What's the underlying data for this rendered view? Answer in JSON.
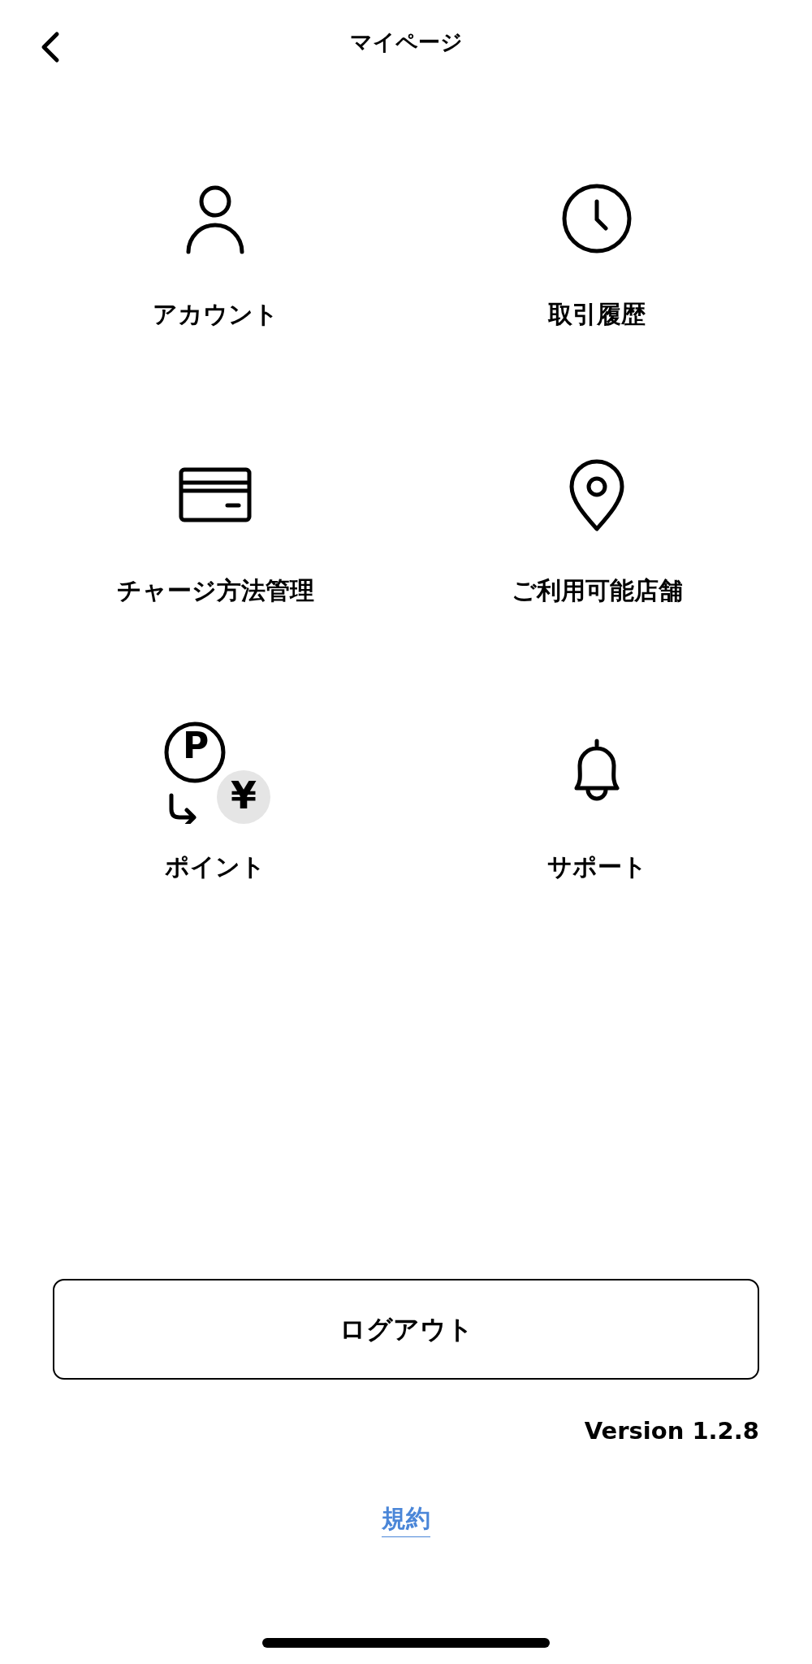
{
  "header": {
    "title": "マイページ"
  },
  "menu": [
    {
      "kind": "person",
      "label": "アカウント"
    },
    {
      "kind": "clock",
      "label": "取引履歴"
    },
    {
      "kind": "card",
      "label": "チャージ方法管理"
    },
    {
      "kind": "pin",
      "label": "ご利用可能店舗"
    },
    {
      "kind": "points",
      "label": "ポイント",
      "glyphs": [
        "P",
        "¥"
      ]
    },
    {
      "kind": "bell",
      "label": "サポート"
    }
  ],
  "logout_button": "ログアウト",
  "version": "Version 1.2.8",
  "terms_link": "規約"
}
